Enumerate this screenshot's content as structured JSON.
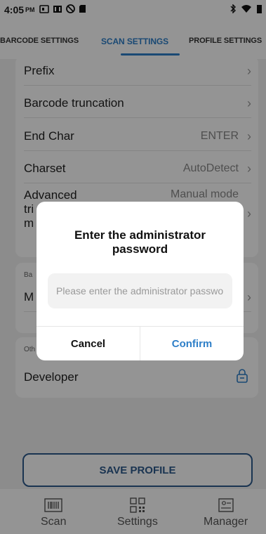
{
  "status": {
    "time": "4:05",
    "ampm": "PM"
  },
  "tabs": [
    {
      "label": "BARCODE SETTINGS"
    },
    {
      "label": "SCAN SETTINGS"
    },
    {
      "label": "PROFILE SETTINGS"
    }
  ],
  "rows": {
    "prefix": {
      "label": "Prefix"
    },
    "truncation": {
      "label": "Barcode truncation"
    },
    "endchar": {
      "label": "End Char",
      "value": "ENTER"
    },
    "charset": {
      "label": "Charset",
      "value": "AutoDetect"
    },
    "advanced": {
      "label_l1": "Advanced",
      "label_l2": "tri",
      "label_l3": "m",
      "value": "Manual mode"
    },
    "group_ba": {
      "label": "Ba"
    },
    "m_row": {
      "label": "M"
    },
    "group_oth": {
      "label": "Oth"
    },
    "developer": {
      "label": "Developer"
    }
  },
  "save_label": "SAVE PROFILE",
  "nav": [
    {
      "label": "Scan",
      "icon": "barcode-icon"
    },
    {
      "label": "Settings",
      "icon": "qr-icon"
    },
    {
      "label": "Manager",
      "icon": "manager-icon"
    }
  ],
  "dialog": {
    "title": "Enter the administrator password",
    "placeholder": "Please enter the administrator password",
    "cancel": "Cancel",
    "confirm": "Confirm"
  },
  "colors": {
    "accent": "#2e7fc8",
    "save_border": "#2d5a8c"
  }
}
